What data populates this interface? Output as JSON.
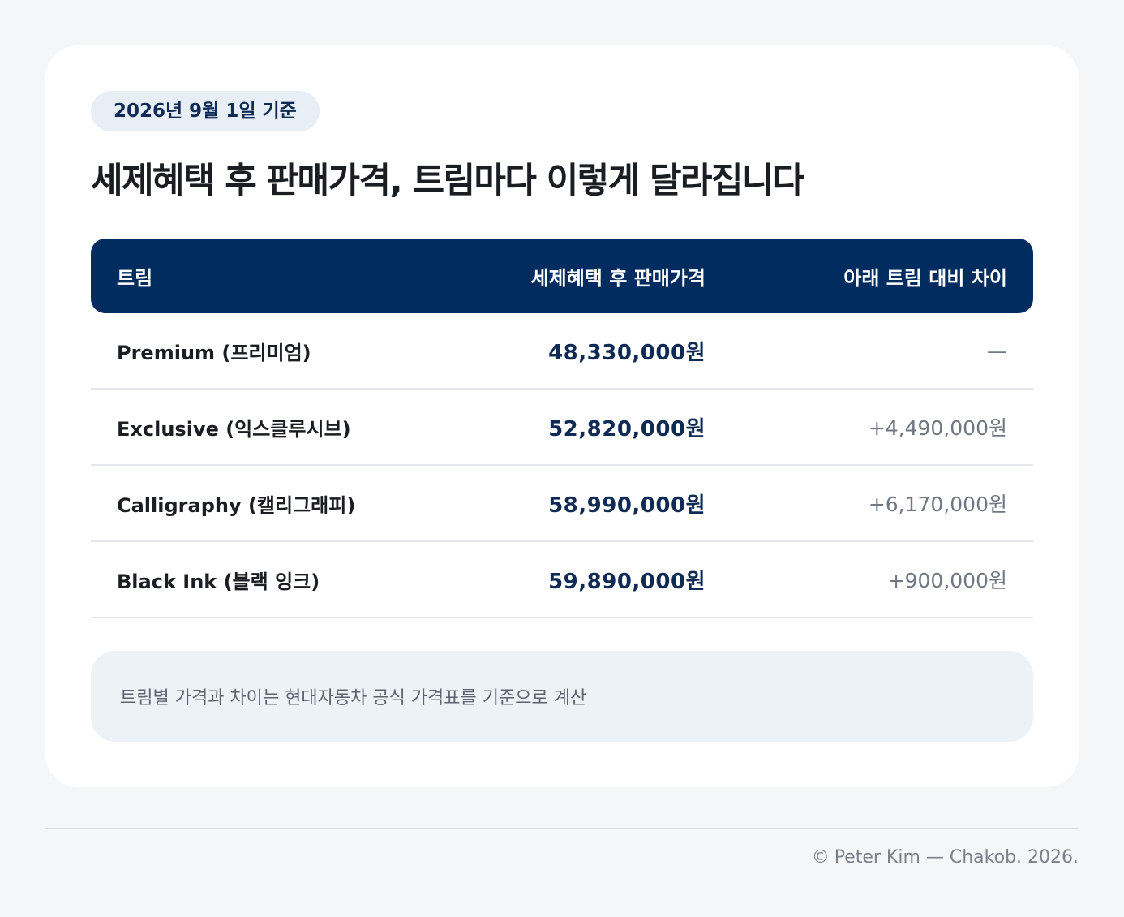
{
  "badge": {
    "date_label": "2026년 9월 1일 기준"
  },
  "header": {
    "title": "세제혜택 후 판매가격, 트림마다 이렇게 달라집니다"
  },
  "table": {
    "columns": [
      "트림",
      "세제혜택 후 판매가격",
      "아래 트림 대비 차이"
    ],
    "rows": [
      {
        "trim": "Premium (프리미엄)",
        "price": "48,330,000원",
        "diff": "—"
      },
      {
        "trim": "Exclusive (익스클루시브)",
        "price": "52,820,000원",
        "diff": "+4,490,000원"
      },
      {
        "trim": "Calligraphy (캘리그래피)",
        "price": "58,990,000원",
        "diff": "+6,170,000원"
      },
      {
        "trim": "Black Ink (블랙 잉크)",
        "price": "59,890,000원",
        "diff": "+900,000원"
      }
    ]
  },
  "note": {
    "text": "트림별 가격과 차이는 현대자동차 공식 가격표를 기준으로 계산"
  },
  "footer": {
    "copyright_symbol": "©",
    "credit": "Peter Kim — Chakob. 2026."
  },
  "colors": {
    "header_bg": "#002c5f",
    "accent_text": "#0e2a55",
    "page_bg": "#f4f6f8"
  }
}
